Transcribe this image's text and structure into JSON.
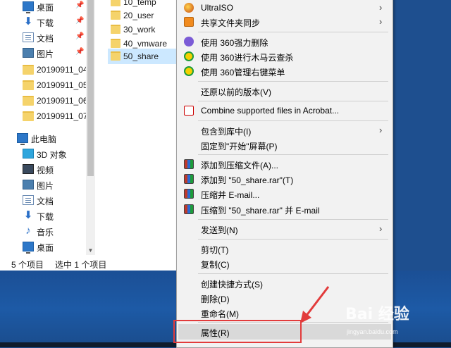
{
  "explorer": {
    "nav": [
      {
        "label": "桌面",
        "icon": "desktop-icon",
        "pinned": true
      },
      {
        "label": "下载",
        "icon": "download-icon",
        "pinned": true
      },
      {
        "label": "文档",
        "icon": "document-icon",
        "pinned": true
      },
      {
        "label": "图片",
        "icon": "picture-icon",
        "pinned": true
      },
      {
        "label": "20190911_04",
        "icon": "folder-icon"
      },
      {
        "label": "20190911_05",
        "icon": "folder-icon"
      },
      {
        "label": "20190911_06",
        "icon": "folder-icon"
      },
      {
        "label": "20190911_07",
        "icon": "folder-icon"
      },
      {
        "label": "此电脑",
        "icon": "this-pc-icon"
      },
      {
        "label": "3D 对象",
        "icon": "3d-objects-icon"
      },
      {
        "label": "视频",
        "icon": "video-icon"
      },
      {
        "label": "图片",
        "icon": "picture-icon"
      },
      {
        "label": "文档",
        "icon": "document-icon"
      },
      {
        "label": "下载",
        "icon": "download-icon"
      },
      {
        "label": "音乐",
        "icon": "music-icon"
      },
      {
        "label": "桌面",
        "icon": "desktop-icon"
      }
    ],
    "files": [
      {
        "label": "10_temp"
      },
      {
        "label": "20_user"
      },
      {
        "label": "30_work"
      },
      {
        "label": "40_vmware"
      },
      {
        "label": "50_share",
        "selected": true
      }
    ],
    "status": {
      "count": "5 个项目",
      "selected": "选中 1 个项目"
    }
  },
  "context_menu": {
    "items": [
      {
        "label": "UltraISO",
        "icon": "ultraiso-icon",
        "submenu": true
      },
      {
        "label": "共享文件夹同步",
        "icon": "share-sync-icon",
        "submenu": true
      },
      {
        "label": "使用 360强力删除",
        "icon": "360-delete-icon"
      },
      {
        "label": "使用 360进行木马云查杀",
        "icon": "360-scan-icon"
      },
      {
        "label": "使用 360管理右键菜单",
        "icon": "360-menu-icon"
      },
      {
        "label": "还原以前的版本(V)"
      },
      {
        "label": "Combine supported files in Acrobat...",
        "icon": "acrobat-icon"
      },
      {
        "label": "包含到库中(I)",
        "submenu": true
      },
      {
        "label": "固定到\"开始\"屏幕(P)"
      },
      {
        "label": "添加到压缩文件(A)...",
        "icon": "winrar-icon"
      },
      {
        "label": "添加到 \"50_share.rar\"(T)",
        "icon": "winrar-icon"
      },
      {
        "label": "压缩并 E-mail...",
        "icon": "winrar-icon"
      },
      {
        "label": "压缩到 \"50_share.rar\" 并 E-mail",
        "icon": "winrar-icon"
      },
      {
        "label": "发送到(N)",
        "submenu": true
      },
      {
        "label": "剪切(T)"
      },
      {
        "label": "复制(C)"
      },
      {
        "label": "创建快捷方式(S)"
      },
      {
        "label": "删除(D)"
      },
      {
        "label": "重命名(M)"
      },
      {
        "label": "属性(R)",
        "highlighted": true
      }
    ]
  },
  "watermark": {
    "logo": "Bai 经验",
    "url": "jingyan.baidu.com"
  },
  "colors": {
    "selection": "#cce8ff",
    "annotation": "#e23b3b",
    "menu_bg": "#f2f2f2",
    "desktop": "#1d5aa6"
  }
}
